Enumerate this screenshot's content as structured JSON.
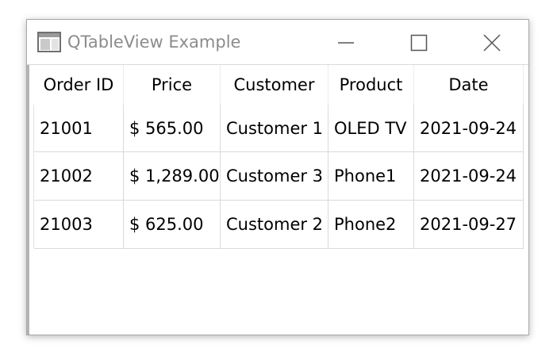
{
  "window": {
    "title": "QTableView Example",
    "controls": [
      "minimize",
      "maximize",
      "close"
    ]
  },
  "table": {
    "columns": [
      "Order ID",
      "Price",
      "Customer",
      "Product",
      "Date"
    ],
    "rows": [
      [
        "21001",
        "$ 565.00",
        "Customer 1",
        "OLED TV",
        "2021-09-24"
      ],
      [
        "21002",
        "$ 1,289.00",
        "Customer 3",
        "Phone1",
        "2021-09-24"
      ],
      [
        "21003",
        "$ 625.00",
        "Customer 2",
        "Phone2",
        "2021-09-27"
      ]
    ]
  },
  "icons": {
    "app": "table-window-icon",
    "minimize": "minimize-icon",
    "maximize": "maximize-icon",
    "close": "close-icon"
  },
  "colors": {
    "title_text": "#8c8c8c",
    "grid": "#dadada",
    "frame": "#a8a8a8"
  }
}
